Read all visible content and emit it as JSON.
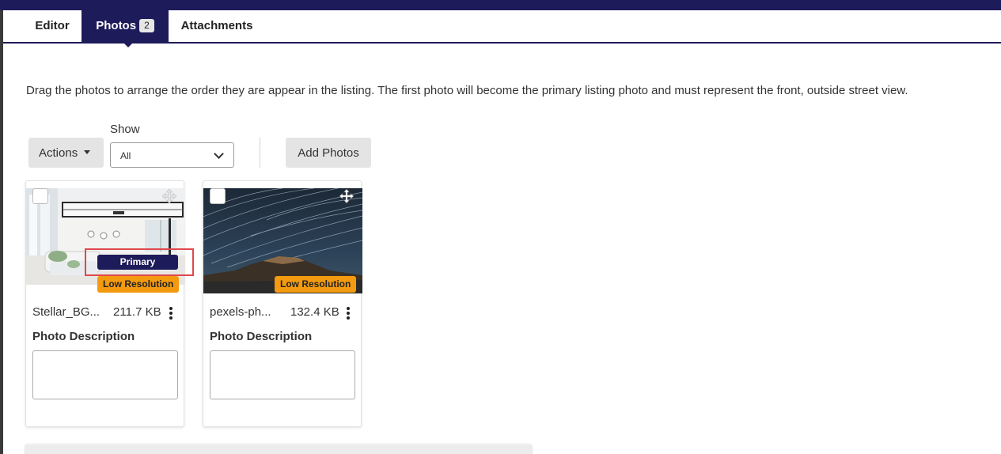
{
  "tabs": [
    {
      "label": "Editor"
    },
    {
      "label": "Photos",
      "count": "2"
    },
    {
      "label": "Attachments"
    }
  ],
  "instructions": "Drag the photos to arrange the order they are appear in the listing. The first photo will become the primary listing photo and must represent the front, outside street view.",
  "toolbar": {
    "actions_label": "Actions",
    "show_label": "Show",
    "show_selected": "All",
    "add_photos_label": "Add Photos"
  },
  "photos": [
    {
      "filename": "Stellar_BG...",
      "size": "211.7 KB",
      "primary_label": "Primary",
      "resolution_badge": "Low Resolution",
      "description_label": "Photo Description",
      "description_value": ""
    },
    {
      "filename": "pexels-ph...",
      "size": "132.4 KB",
      "resolution_badge": "Low Resolution",
      "description_label": "Photo Description",
      "description_value": ""
    }
  ],
  "colors": {
    "brand_navy": "#1e1b5a",
    "badge_orange": "#f39a10",
    "highlight_red": "#e0474c"
  }
}
